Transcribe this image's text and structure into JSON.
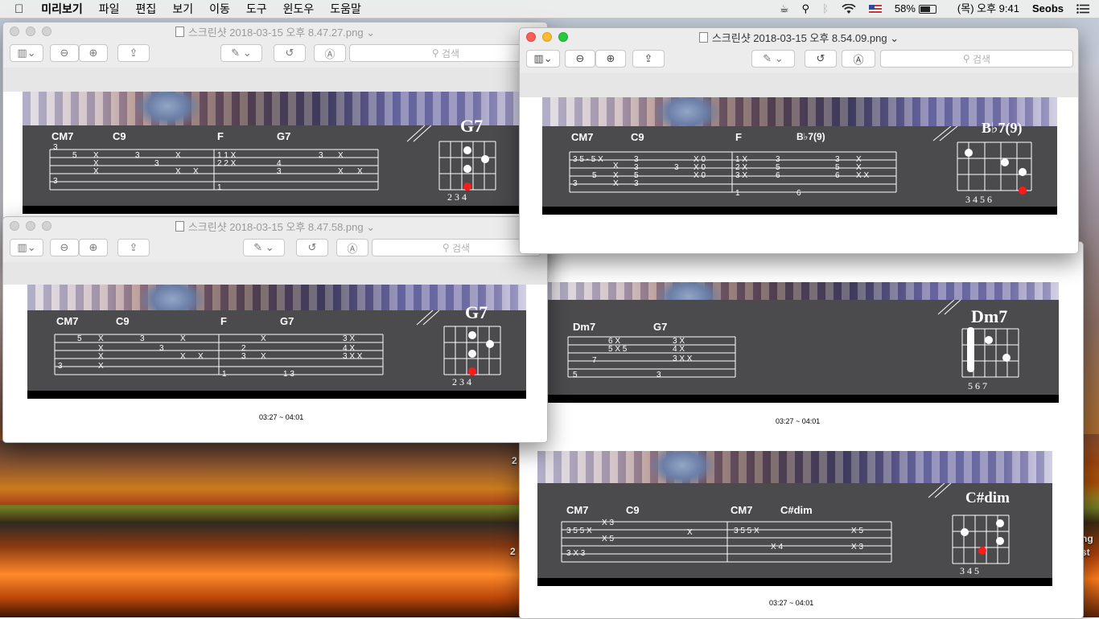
{
  "menubar": {
    "apple": "",
    "app_name": "미리보기",
    "items": [
      "파일",
      "편집",
      "보기",
      "이동",
      "도구",
      "윈도우",
      "도움말"
    ],
    "battery": "58%",
    "clock": "(목) 오후 9:41",
    "user": "Seobs"
  },
  "windows": {
    "w1": {
      "title": "스크린샷 2018-03-15 오후 8.47.27.png",
      "search": "검색"
    },
    "w2": {
      "title": "스크린샷 2018-03-15 오후 8.47.58.png",
      "search": "검색",
      "timecode": "03:27 ~ 04:01"
    },
    "w3": {
      "title": "스크린샷 2018-03-15 오후 8.54.09.png",
      "search": "검색"
    },
    "w4": {
      "timecode": "03:27 ~ 04:01"
    }
  },
  "tabs": {
    "t1": {
      "chords": [
        "CM7",
        "C9",
        "F",
        "G7"
      ],
      "big": "G7",
      "frets": "2  3  4"
    },
    "t2": {
      "chords": [
        "CM7",
        "C9",
        "F",
        "G7"
      ],
      "big": "G7",
      "frets": "2  3  4"
    },
    "t3": {
      "chords": [
        "CM7",
        "C9",
        "F",
        "B♭7(9)"
      ],
      "big": "B♭7(9)",
      "frets": "3  4  5  6"
    },
    "t4": {
      "chords": [
        "Dm7",
        "G7"
      ],
      "big": "Dm7",
      "frets": "5  6  7"
    },
    "t5": {
      "chords": [
        "CM7",
        "C9",
        "CM7",
        "C#dim"
      ],
      "big": "C#dim",
      "frets": "3  4  5"
    }
  },
  "desktop": {
    "edge_left": "2",
    "edge_right_1": "ng",
    "edge_right_2": "st",
    "edge_mid": "2"
  }
}
